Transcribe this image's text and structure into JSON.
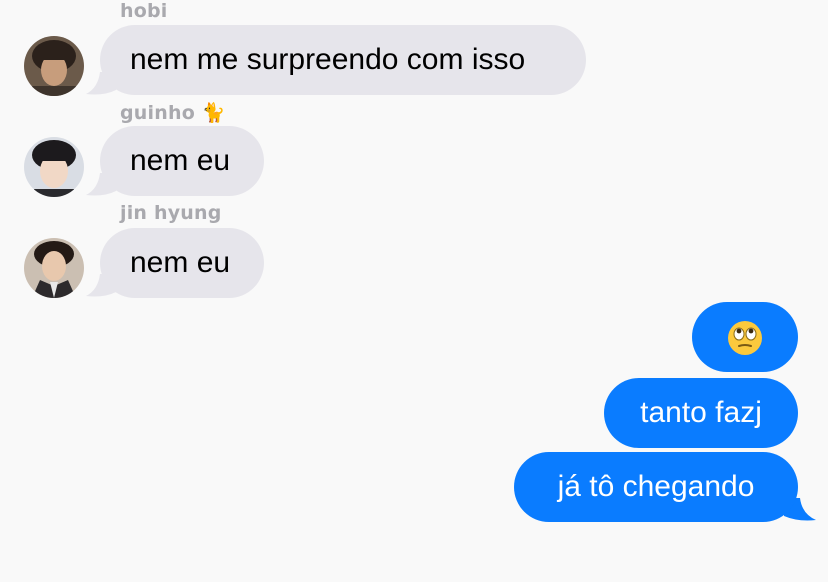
{
  "messages": [
    {
      "sender": "hobi",
      "text": "nem me surpreendo com isso",
      "avatar": "avatar-hobi"
    },
    {
      "sender": "guinho",
      "sender_emoji": "🐈",
      "text": "nem eu",
      "avatar": "avatar-guinho"
    },
    {
      "sender": "jin hyung",
      "text": "nem eu",
      "avatar": "avatar-jin"
    }
  ],
  "outgoing": [
    {
      "text": "",
      "emoji": "face-with-rolling-eyes-icon"
    },
    {
      "text": "tanto fazj"
    },
    {
      "text": "já tô chegando"
    }
  ],
  "colors": {
    "incoming_bubble": "#e6e5eb",
    "outgoing_bubble": "#0a7cff",
    "sender_name": "#a9a9ae",
    "background": "#f9f9f9"
  }
}
